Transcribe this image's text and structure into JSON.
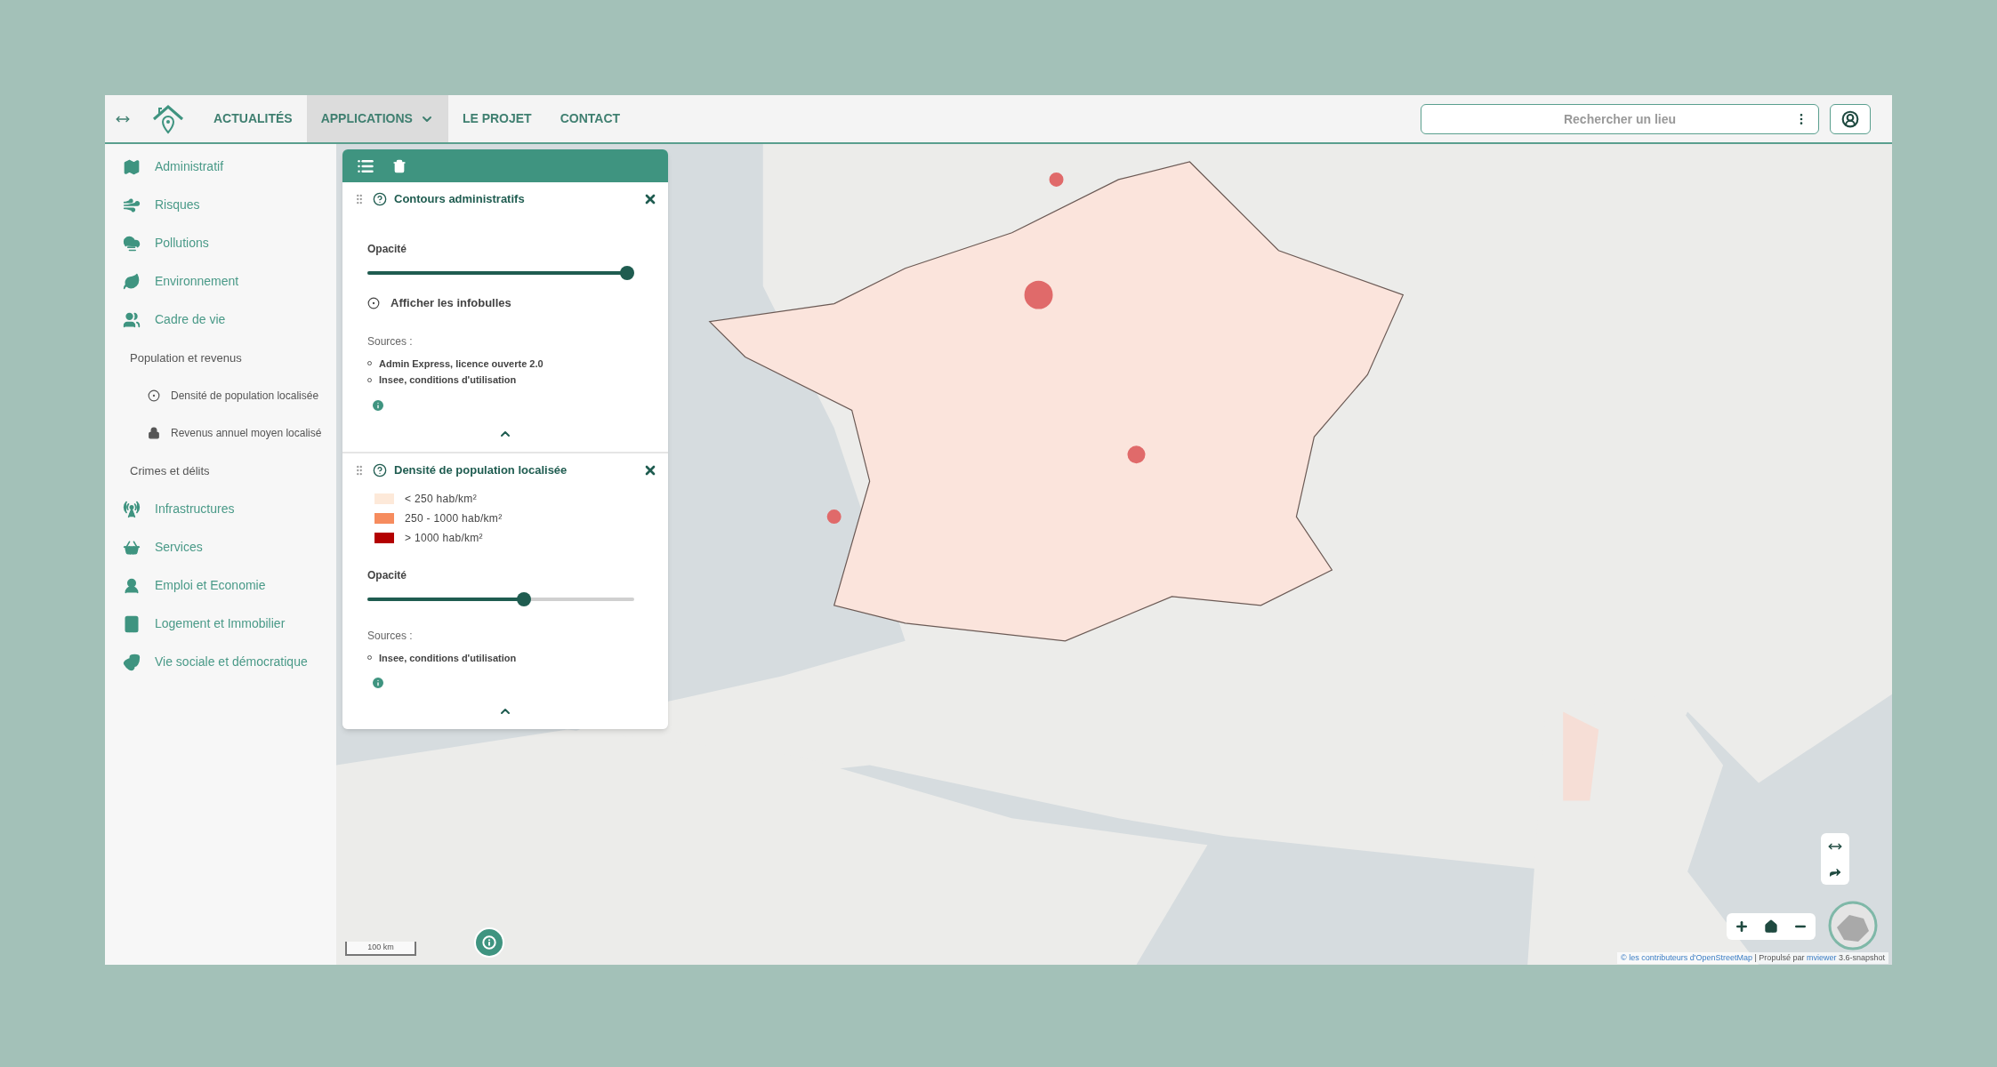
{
  "nav": {
    "items": [
      {
        "label": "ACTUALITÉS",
        "selected": false,
        "dropdown": false
      },
      {
        "label": "APPLICATIONS",
        "selected": true,
        "dropdown": true
      },
      {
        "label": "LE PROJET",
        "selected": false,
        "dropdown": false
      },
      {
        "label": "CONTACT",
        "selected": false,
        "dropdown": false
      }
    ]
  },
  "search": {
    "placeholder": "Rechercher un lieu"
  },
  "sidebar": {
    "items": [
      {
        "label": "Administratif"
      },
      {
        "label": "Risques"
      },
      {
        "label": "Pollutions"
      },
      {
        "label": "Environnement"
      },
      {
        "label": "Cadre de vie",
        "children": [
          {
            "label": "Population et revenus",
            "children": [
              {
                "label": "Densité de population localisée",
                "locked": false
              },
              {
                "label": "Revenus annuel moyen localisé",
                "locked": true
              }
            ]
          },
          {
            "label": "Crimes et délits"
          }
        ]
      },
      {
        "label": "Infrastructures"
      },
      {
        "label": "Services"
      },
      {
        "label": "Emploi et Economie"
      },
      {
        "label": "Logement et Immobilier"
      },
      {
        "label": "Vie sociale et démocratique"
      }
    ]
  },
  "layers": [
    {
      "title": "Contours administratifs",
      "opacity_label": "Opacité",
      "level": 1.0,
      "tooltip_option": {
        "label": "Afficher les infobulles",
        "checked": true
      },
      "sources_label": "Sources :",
      "sources": [
        "Admin Express, licence ouverte 2.0",
        "Insee, conditions d'utilisation"
      ]
    },
    {
      "title": "Densité de population localisée",
      "legend": [
        {
          "label": "< 250 hab/km²",
          "color": "#fde9d9"
        },
        {
          "label": "250 - 1000 hab/km²",
          "color": "#f68c5e"
        },
        {
          "label": "> 1000 hab/km²",
          "color": "#b30000"
        }
      ],
      "opacity_label": "Opacité",
      "level": 0.59,
      "sources_label": "Sources :",
      "sources": [
        "Insee, conditions d'utilisation"
      ]
    }
  ],
  "map": {
    "scale": "100 km",
    "attribution": {
      "osm_link": "© les contributeurs d'OpenStreetMap",
      "text": "| Propulsé par",
      "mviewer_link": "mviewer",
      "version": "3.6-snapshot"
    }
  }
}
